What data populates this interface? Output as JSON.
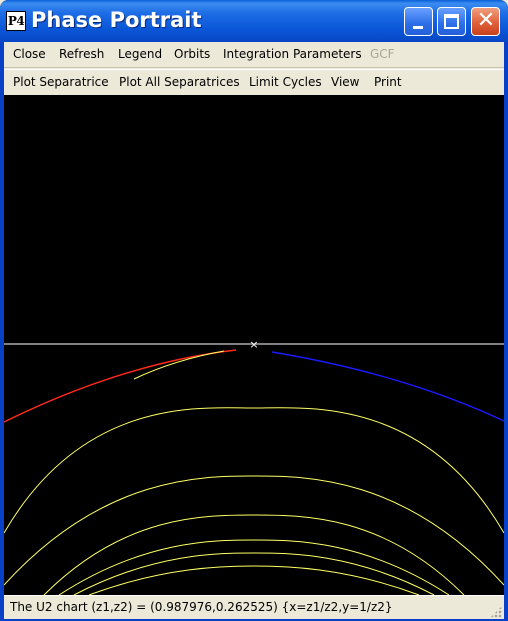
{
  "window": {
    "app_icon": "P4",
    "title": "Phase Portrait",
    "controls": {
      "minimize": "minimize-icon",
      "maximize": "maximize-icon",
      "close": "close-icon",
      "close_glyph": "✕"
    }
  },
  "menu_row1": {
    "items": [
      "Close",
      "Refresh",
      "Legend",
      "Orbits",
      "Integration Parameters",
      "GCF"
    ],
    "disabled": [
      "GCF"
    ]
  },
  "menu_row2": {
    "items": [
      "Plot Separatrice",
      "Plot All Separatrices",
      "Limit Cycles",
      "View",
      "Print"
    ]
  },
  "plot": {
    "background": "#000000",
    "colors": {
      "axis": "#ffffff",
      "orbit": "#ffff66",
      "unstable_separatrix": "#ff2a1a",
      "stable_separatrix": "#1a1aff",
      "singular_point": "#ffffff"
    },
    "singular_point_marker": "×"
  },
  "status": {
    "text": "The U2 chart  (z1,z2) = (0.987976,0.262525) {x=z1/z2,y=1/z2}"
  }
}
